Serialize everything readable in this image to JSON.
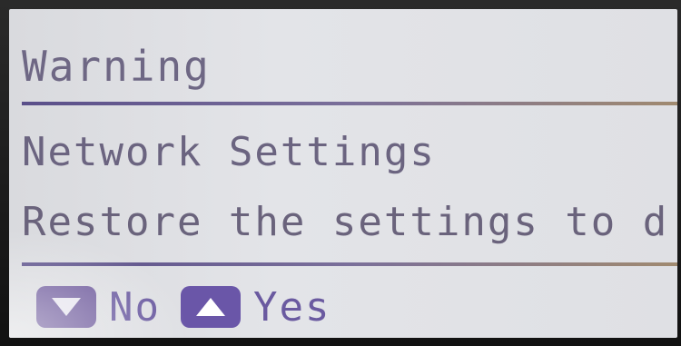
{
  "dialog": {
    "title": "Warning",
    "subtitle": "Network Settings",
    "message": "Restore the settings to d"
  },
  "actions": {
    "no_label": "No",
    "yes_label": "Yes",
    "no_icon": "triangle-down-icon",
    "yes_icon": "triangle-up-icon"
  },
  "colors": {
    "screen_bg": "#e0e1e5",
    "text": "#6a637c",
    "key_bg": "#6a56a8",
    "separator": "#6a5f8e"
  }
}
